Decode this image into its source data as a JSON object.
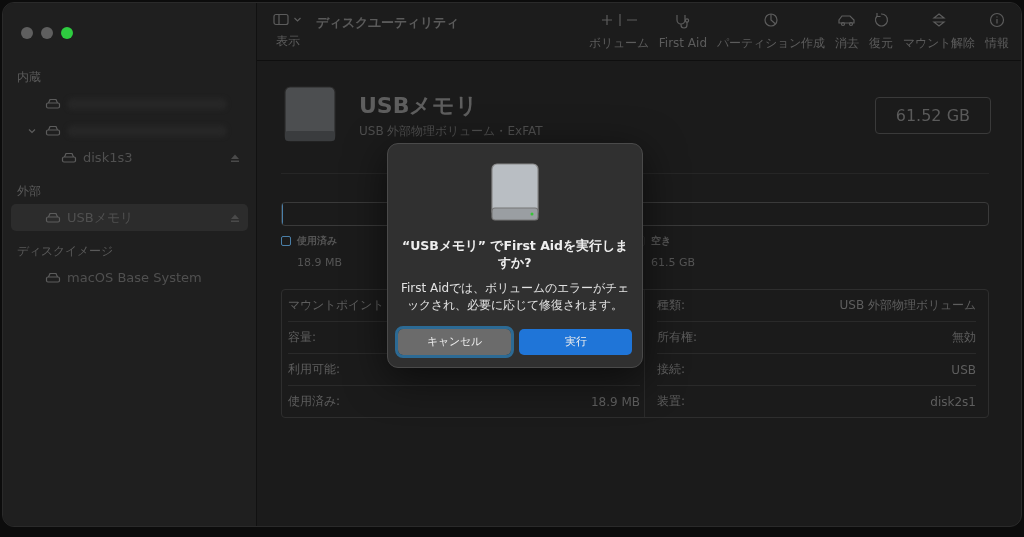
{
  "sidebar": {
    "sections": [
      {
        "title": "内蔵",
        "items": [
          {
            "kind": "redacted",
            "selected": false,
            "ejectable": false
          },
          {
            "kind": "redacted",
            "selected": false,
            "ejectable": false,
            "expanded": true,
            "children": [
              {
                "kind": "disk",
                "label": "disk1s3",
                "selected": false,
                "ejectable": true
              }
            ]
          }
        ]
      },
      {
        "title": "外部",
        "items": [
          {
            "kind": "disk",
            "label": "USBメモリ",
            "selected": true,
            "ejectable": true
          }
        ]
      },
      {
        "title": "ディスクイメージ",
        "items": [
          {
            "kind": "disk",
            "label": "macOS Base System",
            "selected": false,
            "ejectable": false
          }
        ]
      }
    ]
  },
  "toolbar": {
    "view_label": "表示",
    "title": "ディスクユーティリティ",
    "buttons": [
      {
        "kind": "volume",
        "label": "ボリューム"
      },
      {
        "kind": "firstaid",
        "label": "First Aid"
      },
      {
        "kind": "partition",
        "label": "パーティション作成"
      },
      {
        "kind": "erase",
        "label": "消去"
      },
      {
        "kind": "restore",
        "label": "復元"
      },
      {
        "kind": "unmount",
        "label": "マウント解除"
      },
      {
        "kind": "info",
        "label": "情報"
      }
    ]
  },
  "volume": {
    "name": "USBメモリ",
    "subtitle": "USB 外部物理ボリューム・ExFAT",
    "capacity": "61.52 GB",
    "usage": {
      "level": 0.0003,
      "legend": [
        {
          "label": "使用済み",
          "value": "18.9 MB",
          "color": "#4a7fa8"
        },
        {
          "label": "空き",
          "value": "61.5 GB",
          "color": "#2a2a2a"
        }
      ]
    },
    "info_left": [
      {
        "label": "マウントポイント"
      },
      {
        "label": "容量:"
      },
      {
        "label": "利用可能:"
      },
      {
        "label": "使用済み:",
        "value": "18.9 MB"
      }
    ],
    "info_right": [
      {
        "label": "種類:",
        "value": "USB 外部物理ボリューム"
      },
      {
        "label": "所有権:",
        "value": "無効"
      },
      {
        "label": "接続:",
        "value": "USB"
      },
      {
        "label": "装置:",
        "value": "disk2s1"
      }
    ]
  },
  "dialog": {
    "title": "“USBメモリ” でFirst Aidを実行しますか?",
    "message": "First Aidでは、ボリュームのエラーがチェックされ、必要に応じて修復されます。",
    "buttons": [
      {
        "label": "キャンセル",
        "kind": "cancel",
        "focused": true
      },
      {
        "label": "実行",
        "kind": "default",
        "focused": false
      }
    ]
  }
}
